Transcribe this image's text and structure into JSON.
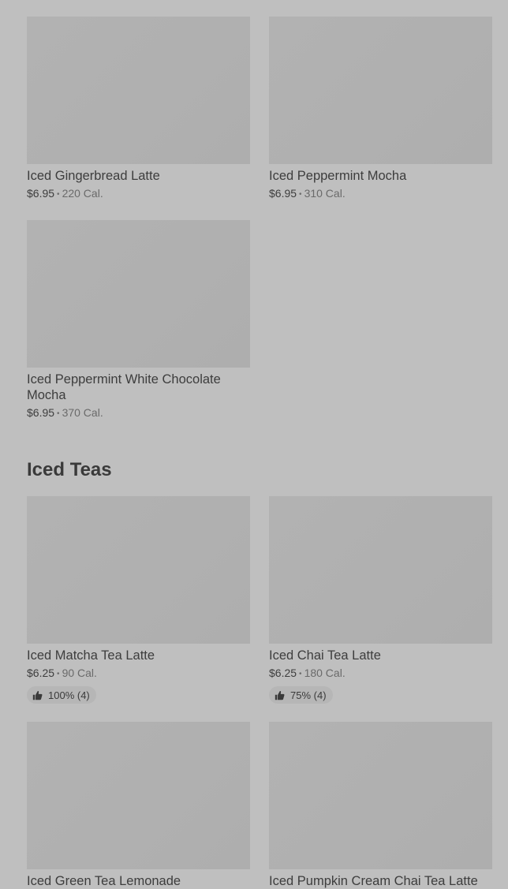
{
  "items": [
    {
      "name": "Iced Gingerbread Latte",
      "price": "$6.95",
      "calories": "220 Cal."
    },
    {
      "name": "Iced Peppermint Mocha",
      "price": "$6.95",
      "calories": "310 Cal."
    },
    {
      "name": "Iced Peppermint White Chocolate Mocha",
      "price": "$6.95",
      "calories": "370 Cal."
    }
  ],
  "section": {
    "title": "Iced Teas"
  },
  "teas": [
    {
      "name": "Iced Matcha Tea Latte",
      "price": "$6.25",
      "calories": "90 Cal.",
      "rating": "100% (4)"
    },
    {
      "name": "Iced Chai Tea Latte",
      "price": "$6.25",
      "calories": "180 Cal.",
      "rating": "75% (4)"
    },
    {
      "name": "Iced Green Tea Lemonade"
    },
    {
      "name": "Iced Pumpkin Cream Chai Tea Latte"
    }
  ],
  "icons": {
    "rating": "thumbs-up-icon"
  },
  "colors": {
    "background": "#bfbfbf",
    "placeholder": "#b1b1b1",
    "text": "#3a3a3a",
    "muted": "#6a6a6a"
  }
}
